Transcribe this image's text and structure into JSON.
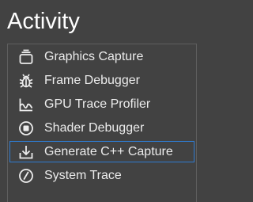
{
  "header": {
    "title": "Activity"
  },
  "activities": [
    {
      "label": "Graphics Capture",
      "icon": "graphics-capture-icon",
      "selected": false
    },
    {
      "label": "Frame Debugger",
      "icon": "bug-icon",
      "selected": false
    },
    {
      "label": "GPU Trace Profiler",
      "icon": "chart-icon",
      "selected": false
    },
    {
      "label": "Shader Debugger",
      "icon": "shader-icon",
      "selected": false
    },
    {
      "label": "Generate C++ Capture",
      "icon": "download-tray-icon",
      "selected": true
    },
    {
      "label": "System Trace",
      "icon": "gauge-icon",
      "selected": false
    }
  ],
  "colors": {
    "background": "#424242",
    "selection_border": "#2f7bd0",
    "text": "#ececec"
  }
}
